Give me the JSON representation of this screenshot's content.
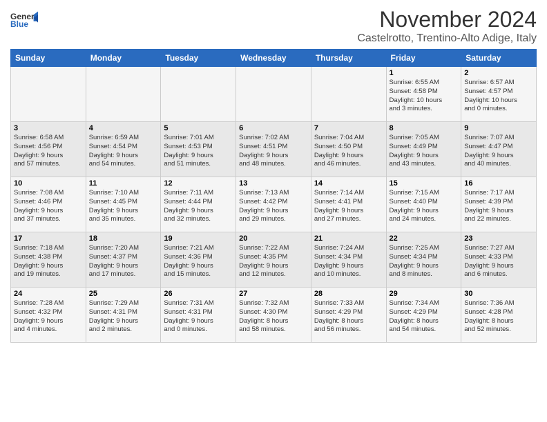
{
  "header": {
    "logo_general": "General",
    "logo_blue": "Blue",
    "month_title": "November 2024",
    "location": "Castelrotto, Trentino-Alto Adige, Italy"
  },
  "weekdays": [
    "Sunday",
    "Monday",
    "Tuesday",
    "Wednesday",
    "Thursday",
    "Friday",
    "Saturday"
  ],
  "weeks": [
    [
      {
        "day": "",
        "info": ""
      },
      {
        "day": "",
        "info": ""
      },
      {
        "day": "",
        "info": ""
      },
      {
        "day": "",
        "info": ""
      },
      {
        "day": "",
        "info": ""
      },
      {
        "day": "1",
        "info": "Sunrise: 6:55 AM\nSunset: 4:58 PM\nDaylight: 10 hours\nand 3 minutes."
      },
      {
        "day": "2",
        "info": "Sunrise: 6:57 AM\nSunset: 4:57 PM\nDaylight: 10 hours\nand 0 minutes."
      }
    ],
    [
      {
        "day": "3",
        "info": "Sunrise: 6:58 AM\nSunset: 4:56 PM\nDaylight: 9 hours\nand 57 minutes."
      },
      {
        "day": "4",
        "info": "Sunrise: 6:59 AM\nSunset: 4:54 PM\nDaylight: 9 hours\nand 54 minutes."
      },
      {
        "day": "5",
        "info": "Sunrise: 7:01 AM\nSunset: 4:53 PM\nDaylight: 9 hours\nand 51 minutes."
      },
      {
        "day": "6",
        "info": "Sunrise: 7:02 AM\nSunset: 4:51 PM\nDaylight: 9 hours\nand 48 minutes."
      },
      {
        "day": "7",
        "info": "Sunrise: 7:04 AM\nSunset: 4:50 PM\nDaylight: 9 hours\nand 46 minutes."
      },
      {
        "day": "8",
        "info": "Sunrise: 7:05 AM\nSunset: 4:49 PM\nDaylight: 9 hours\nand 43 minutes."
      },
      {
        "day": "9",
        "info": "Sunrise: 7:07 AM\nSunset: 4:47 PM\nDaylight: 9 hours\nand 40 minutes."
      }
    ],
    [
      {
        "day": "10",
        "info": "Sunrise: 7:08 AM\nSunset: 4:46 PM\nDaylight: 9 hours\nand 37 minutes."
      },
      {
        "day": "11",
        "info": "Sunrise: 7:10 AM\nSunset: 4:45 PM\nDaylight: 9 hours\nand 35 minutes."
      },
      {
        "day": "12",
        "info": "Sunrise: 7:11 AM\nSunset: 4:44 PM\nDaylight: 9 hours\nand 32 minutes."
      },
      {
        "day": "13",
        "info": "Sunrise: 7:13 AM\nSunset: 4:42 PM\nDaylight: 9 hours\nand 29 minutes."
      },
      {
        "day": "14",
        "info": "Sunrise: 7:14 AM\nSunset: 4:41 PM\nDaylight: 9 hours\nand 27 minutes."
      },
      {
        "day": "15",
        "info": "Sunrise: 7:15 AM\nSunset: 4:40 PM\nDaylight: 9 hours\nand 24 minutes."
      },
      {
        "day": "16",
        "info": "Sunrise: 7:17 AM\nSunset: 4:39 PM\nDaylight: 9 hours\nand 22 minutes."
      }
    ],
    [
      {
        "day": "17",
        "info": "Sunrise: 7:18 AM\nSunset: 4:38 PM\nDaylight: 9 hours\nand 19 minutes."
      },
      {
        "day": "18",
        "info": "Sunrise: 7:20 AM\nSunset: 4:37 PM\nDaylight: 9 hours\nand 17 minutes."
      },
      {
        "day": "19",
        "info": "Sunrise: 7:21 AM\nSunset: 4:36 PM\nDaylight: 9 hours\nand 15 minutes."
      },
      {
        "day": "20",
        "info": "Sunrise: 7:22 AM\nSunset: 4:35 PM\nDaylight: 9 hours\nand 12 minutes."
      },
      {
        "day": "21",
        "info": "Sunrise: 7:24 AM\nSunset: 4:34 PM\nDaylight: 9 hours\nand 10 minutes."
      },
      {
        "day": "22",
        "info": "Sunrise: 7:25 AM\nSunset: 4:34 PM\nDaylight: 9 hours\nand 8 minutes."
      },
      {
        "day": "23",
        "info": "Sunrise: 7:27 AM\nSunset: 4:33 PM\nDaylight: 9 hours\nand 6 minutes."
      }
    ],
    [
      {
        "day": "24",
        "info": "Sunrise: 7:28 AM\nSunset: 4:32 PM\nDaylight: 9 hours\nand 4 minutes."
      },
      {
        "day": "25",
        "info": "Sunrise: 7:29 AM\nSunset: 4:31 PM\nDaylight: 9 hours\nand 2 minutes."
      },
      {
        "day": "26",
        "info": "Sunrise: 7:31 AM\nSunset: 4:31 PM\nDaylight: 9 hours\nand 0 minutes."
      },
      {
        "day": "27",
        "info": "Sunrise: 7:32 AM\nSunset: 4:30 PM\nDaylight: 8 hours\nand 58 minutes."
      },
      {
        "day": "28",
        "info": "Sunrise: 7:33 AM\nSunset: 4:29 PM\nDaylight: 8 hours\nand 56 minutes."
      },
      {
        "day": "29",
        "info": "Sunrise: 7:34 AM\nSunset: 4:29 PM\nDaylight: 8 hours\nand 54 minutes."
      },
      {
        "day": "30",
        "info": "Sunrise: 7:36 AM\nSunset: 4:28 PM\nDaylight: 8 hours\nand 52 minutes."
      }
    ]
  ]
}
